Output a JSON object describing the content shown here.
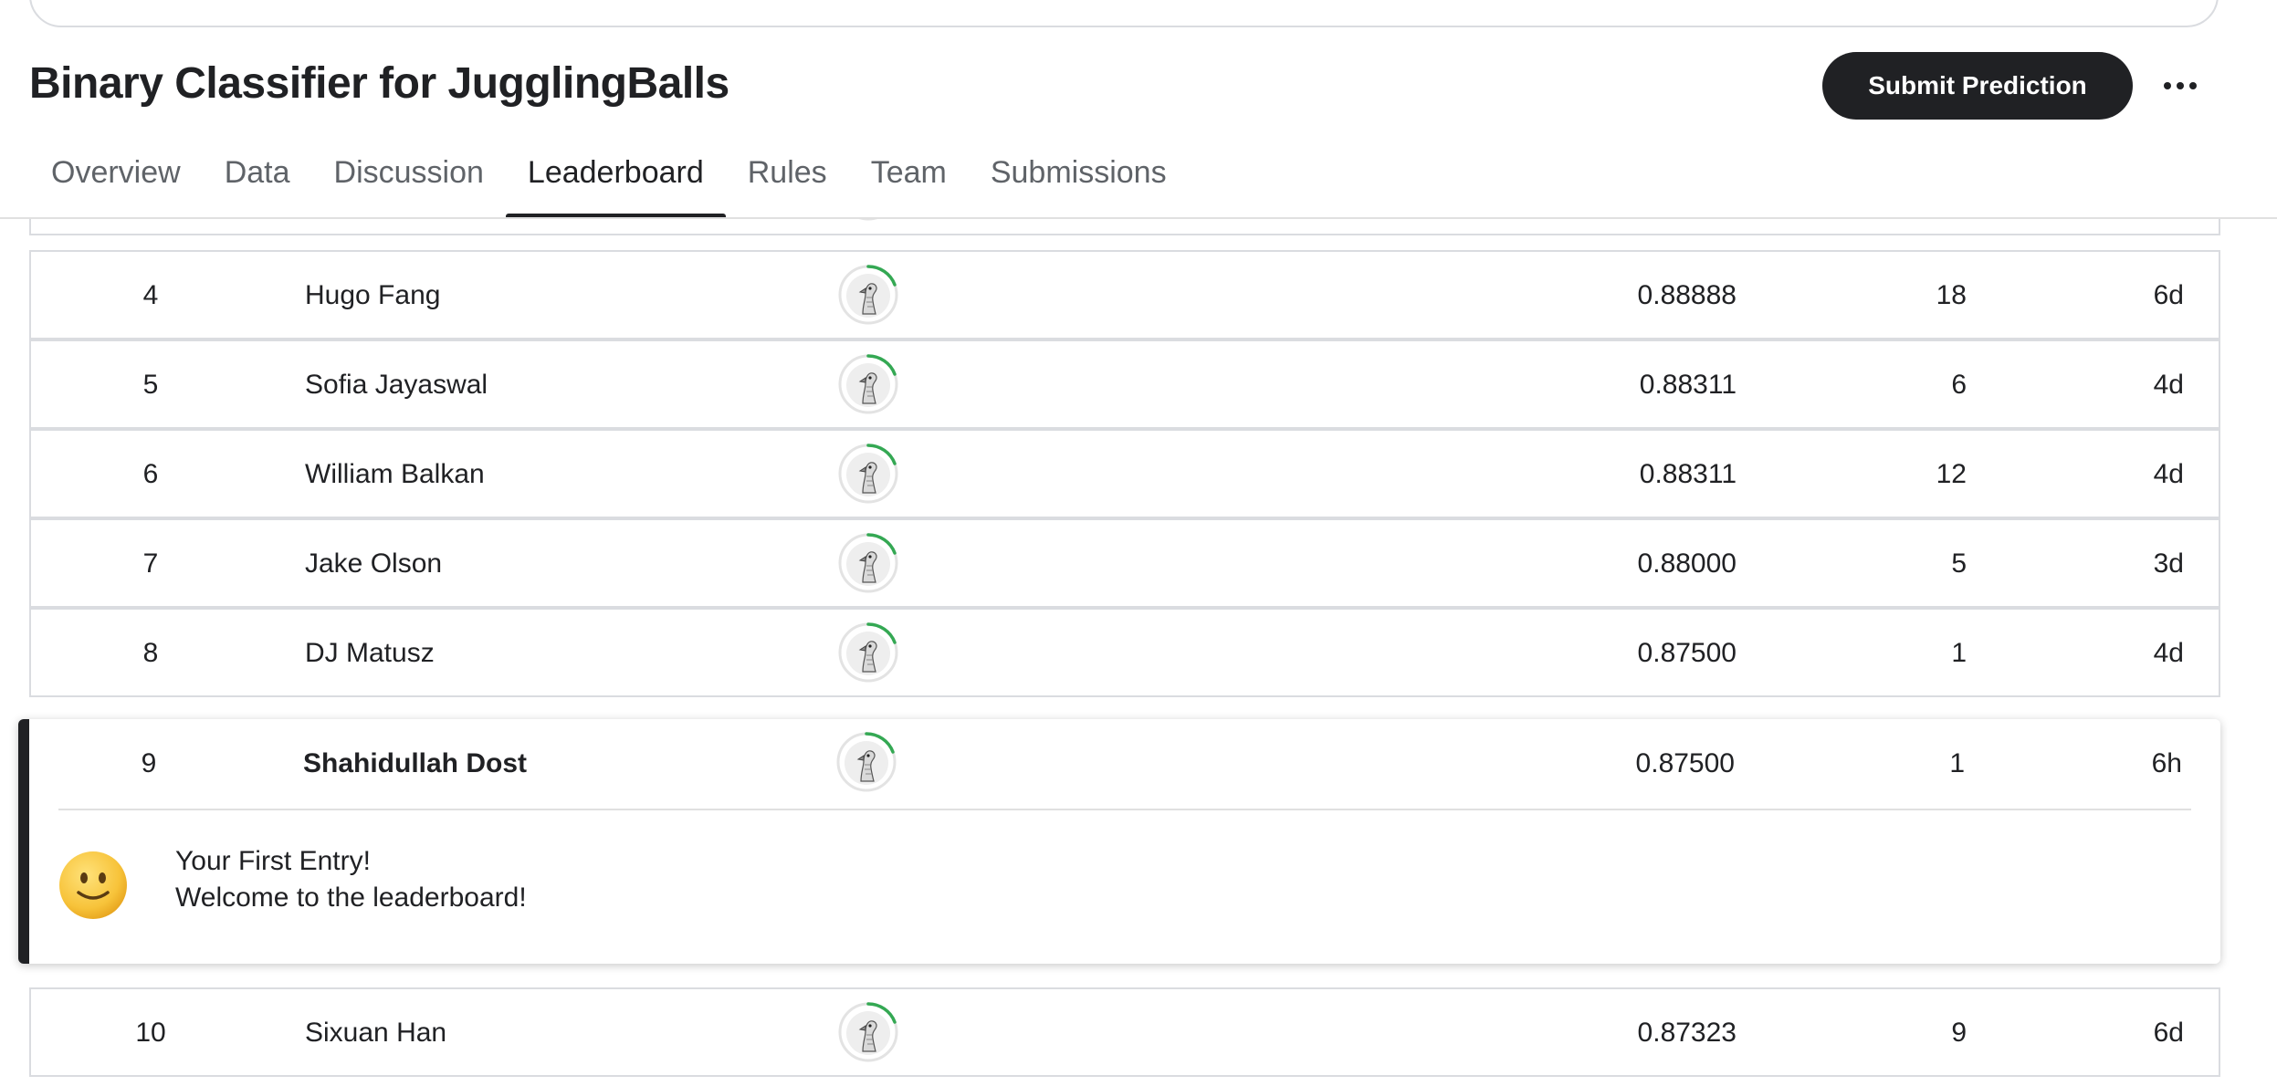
{
  "header": {
    "title": "Binary Classifier for JugglingBalls",
    "submit_label": "Submit Prediction"
  },
  "tabs": [
    {
      "label": "Overview"
    },
    {
      "label": "Data"
    },
    {
      "label": "Discussion"
    },
    {
      "label": "Leaderboard",
      "active": true
    },
    {
      "label": "Rules"
    },
    {
      "label": "Team"
    },
    {
      "label": "Submissions"
    }
  ],
  "leaderboard": {
    "rows": [
      {
        "rank": "4",
        "name": "Hugo Fang",
        "score": "0.88888",
        "entries": "18",
        "last": "6d"
      },
      {
        "rank": "5",
        "name": "Sofia Jayaswal",
        "score": "0.88311",
        "entries": "6",
        "last": "4d"
      },
      {
        "rank": "6",
        "name": "William Balkan",
        "score": "0.88311",
        "entries": "12",
        "last": "4d"
      },
      {
        "rank": "7",
        "name": "Jake Olson",
        "score": "0.88000",
        "entries": "5",
        "last": "3d"
      },
      {
        "rank": "8",
        "name": "DJ Matusz",
        "score": "0.87500",
        "entries": "1",
        "last": "4d"
      }
    ],
    "me": {
      "rank": "9",
      "name": "Shahidullah Dost",
      "score": "0.87500",
      "entries": "1",
      "last": "6h"
    },
    "after": [
      {
        "rank": "10",
        "name": "Sixuan Han",
        "score": "0.87323",
        "entries": "9",
        "last": "6d"
      }
    ]
  },
  "welcome": {
    "line1": "Your First Entry!",
    "line2": "Welcome to the leaderboard!"
  },
  "colors": {
    "accent_dark": "#202124",
    "progress_green": "#34a853",
    "border": "#dadce0"
  },
  "icons": {
    "avatar": "default-goose-avatar-icon",
    "more": "more-options-icon",
    "smiley": "smiley-face-icon"
  }
}
